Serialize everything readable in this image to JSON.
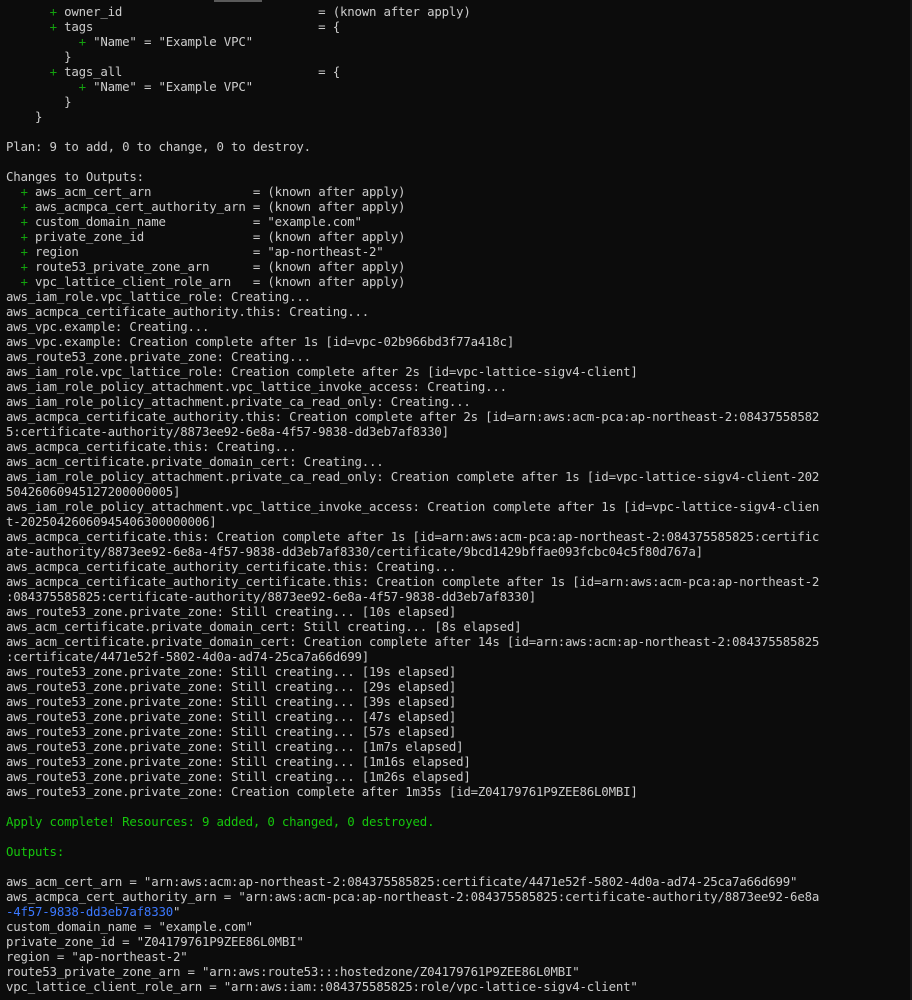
{
  "colors": {
    "background": "#0c0c0c",
    "text": "#cccccc",
    "plus": "#13a10e",
    "success": "#16c60c",
    "wrap_highlight": "#3b78ff"
  },
  "lines": [
    {
      "segs": [
        {
          "t": "      "
        },
        {
          "t": "+",
          "c": "plus"
        },
        {
          "t": " owner_id                           = (known after apply)"
        }
      ]
    },
    {
      "segs": [
        {
          "t": "      "
        },
        {
          "t": "+",
          "c": "plus"
        },
        {
          "t": " tags                               = {"
        }
      ]
    },
    {
      "segs": [
        {
          "t": "          "
        },
        {
          "t": "+",
          "c": "plus"
        },
        {
          "t": " \"Name\" = \"Example VPC\""
        }
      ]
    },
    {
      "segs": [
        {
          "t": "        }"
        }
      ]
    },
    {
      "segs": [
        {
          "t": "      "
        },
        {
          "t": "+",
          "c": "plus"
        },
        {
          "t": " tags_all                           = {"
        }
      ]
    },
    {
      "segs": [
        {
          "t": "          "
        },
        {
          "t": "+",
          "c": "plus"
        },
        {
          "t": " \"Name\" = \"Example VPC\""
        }
      ]
    },
    {
      "segs": [
        {
          "t": "        }"
        }
      ]
    },
    {
      "segs": [
        {
          "t": "    }"
        }
      ]
    },
    {
      "segs": [
        {
          "t": ""
        }
      ]
    },
    {
      "segs": [
        {
          "t": "Plan: 9 to add, 0 to change, 0 to destroy."
        }
      ]
    },
    {
      "segs": [
        {
          "t": ""
        }
      ]
    },
    {
      "segs": [
        {
          "t": "Changes to Outputs:"
        }
      ]
    },
    {
      "segs": [
        {
          "t": "  "
        },
        {
          "t": "+",
          "c": "plus"
        },
        {
          "t": " aws_acm_cert_arn              = (known after apply)"
        }
      ]
    },
    {
      "segs": [
        {
          "t": "  "
        },
        {
          "t": "+",
          "c": "plus"
        },
        {
          "t": " aws_acmpca_cert_authority_arn = (known after apply)"
        }
      ]
    },
    {
      "segs": [
        {
          "t": "  "
        },
        {
          "t": "+",
          "c": "plus"
        },
        {
          "t": " custom_domain_name            = \"example.com\""
        }
      ]
    },
    {
      "segs": [
        {
          "t": "  "
        },
        {
          "t": "+",
          "c": "plus"
        },
        {
          "t": " private_zone_id               = (known after apply)"
        }
      ]
    },
    {
      "segs": [
        {
          "t": "  "
        },
        {
          "t": "+",
          "c": "plus"
        },
        {
          "t": " region                        = \"ap-northeast-2\""
        }
      ]
    },
    {
      "segs": [
        {
          "t": "  "
        },
        {
          "t": "+",
          "c": "plus"
        },
        {
          "t": " route53_private_zone_arn      = (known after apply)"
        }
      ]
    },
    {
      "segs": [
        {
          "t": "  "
        },
        {
          "t": "+",
          "c": "plus"
        },
        {
          "t": " vpc_lattice_client_role_arn   = (known after apply)"
        }
      ]
    },
    {
      "segs": [
        {
          "t": "aws_iam_role.vpc_lattice_role: Creating..."
        }
      ]
    },
    {
      "segs": [
        {
          "t": "aws_acmpca_certificate_authority.this: Creating..."
        }
      ]
    },
    {
      "segs": [
        {
          "t": "aws_vpc.example: Creating..."
        }
      ]
    },
    {
      "segs": [
        {
          "t": "aws_vpc.example: Creation complete after 1s [id=vpc-02b966bd3f77a418c]"
        }
      ]
    },
    {
      "segs": [
        {
          "t": "aws_route53_zone.private_zone: Creating..."
        }
      ]
    },
    {
      "segs": [
        {
          "t": "aws_iam_role.vpc_lattice_role: Creation complete after 2s [id=vpc-lattice-sigv4-client]"
        }
      ]
    },
    {
      "segs": [
        {
          "t": "aws_iam_role_policy_attachment.vpc_lattice_invoke_access: Creating..."
        }
      ]
    },
    {
      "segs": [
        {
          "t": "aws_iam_role_policy_attachment.private_ca_read_only: Creating..."
        }
      ]
    },
    {
      "segs": [
        {
          "t": "aws_acmpca_certificate_authority.this: Creation complete after 2s [id=arn:aws:acm-pca:ap-northeast-2:08437558582"
        }
      ]
    },
    {
      "segs": [
        {
          "t": "5:certificate-authority/8873ee92-6e8a-4f57-9838-dd3eb7af8330]"
        }
      ]
    },
    {
      "segs": [
        {
          "t": "aws_acmpca_certificate.this: Creating..."
        }
      ]
    },
    {
      "segs": [
        {
          "t": "aws_acm_certificate.private_domain_cert: Creating..."
        }
      ]
    },
    {
      "segs": [
        {
          "t": "aws_iam_role_policy_attachment.private_ca_read_only: Creation complete after 1s [id=vpc-lattice-sigv4-client-202"
        }
      ]
    },
    {
      "segs": [
        {
          "t": "50426060945127200000005]"
        }
      ]
    },
    {
      "segs": [
        {
          "t": "aws_iam_role_policy_attachment.vpc_lattice_invoke_access: Creation complete after 1s [id=vpc-lattice-sigv4-clien"
        }
      ]
    },
    {
      "segs": [
        {
          "t": "t-20250426060945406300000006]"
        }
      ]
    },
    {
      "segs": [
        {
          "t": "aws_acmpca_certificate.this: Creation complete after 1s [id=arn:aws:acm-pca:ap-northeast-2:084375585825:certific"
        }
      ]
    },
    {
      "segs": [
        {
          "t": "ate-authority/8873ee92-6e8a-4f57-9838-dd3eb7af8330/certificate/9bcd1429bffae093fcbc04c5f80d767a]"
        }
      ]
    },
    {
      "segs": [
        {
          "t": "aws_acmpca_certificate_authority_certificate.this: Creating..."
        }
      ]
    },
    {
      "segs": [
        {
          "t": "aws_acmpca_certificate_authority_certificate.this: Creation complete after 1s [id=arn:aws:acm-pca:ap-northeast-2"
        }
      ]
    },
    {
      "segs": [
        {
          "t": ":084375585825:certificate-authority/8873ee92-6e8a-4f57-9838-dd3eb7af8330]"
        }
      ]
    },
    {
      "segs": [
        {
          "t": "aws_route53_zone.private_zone: Still creating... [10s elapsed]"
        }
      ]
    },
    {
      "segs": [
        {
          "t": "aws_acm_certificate.private_domain_cert: Still creating... [8s elapsed]"
        }
      ]
    },
    {
      "segs": [
        {
          "t": "aws_acm_certificate.private_domain_cert: Creation complete after 14s [id=arn:aws:acm:ap-northeast-2:084375585825"
        }
      ]
    },
    {
      "segs": [
        {
          "t": ":certificate/4471e52f-5802-4d0a-ad74-25ca7a66d699]"
        }
      ]
    },
    {
      "segs": [
        {
          "t": "aws_route53_zone.private_zone: Still creating... [19s elapsed]"
        }
      ]
    },
    {
      "segs": [
        {
          "t": "aws_route53_zone.private_zone: Still creating... [29s elapsed]"
        }
      ]
    },
    {
      "segs": [
        {
          "t": "aws_route53_zone.private_zone: Still creating... [39s elapsed]"
        }
      ]
    },
    {
      "segs": [
        {
          "t": "aws_route53_zone.private_zone: Still creating... [47s elapsed]"
        }
      ]
    },
    {
      "segs": [
        {
          "t": "aws_route53_zone.private_zone: Still creating... [57s elapsed]"
        }
      ]
    },
    {
      "segs": [
        {
          "t": "aws_route53_zone.private_zone: Still creating... [1m7s elapsed]"
        }
      ]
    },
    {
      "segs": [
        {
          "t": "aws_route53_zone.private_zone: Still creating... [1m16s elapsed]"
        }
      ]
    },
    {
      "segs": [
        {
          "t": "aws_route53_zone.private_zone: Still creating... [1m26s elapsed]"
        }
      ]
    },
    {
      "segs": [
        {
          "t": "aws_route53_zone.private_zone: Creation complete after 1m35s [id=Z04179761P9ZEE86L0MBI]"
        }
      ]
    },
    {
      "segs": [
        {
          "t": ""
        }
      ]
    },
    {
      "segs": [
        {
          "t": "Apply complete! Resources: 9 added, 0 changed, 0 destroyed.",
          "c": "green"
        }
      ]
    },
    {
      "segs": [
        {
          "t": ""
        }
      ]
    },
    {
      "segs": [
        {
          "t": "Outputs:",
          "c": "green"
        }
      ]
    },
    {
      "segs": [
        {
          "t": ""
        }
      ]
    },
    {
      "segs": [
        {
          "t": "aws_acm_cert_arn = \"arn:aws:acm:ap-northeast-2:084375585825:certificate/4471e52f-5802-4d0a-ad74-25ca7a66d699\""
        }
      ]
    },
    {
      "segs": [
        {
          "t": "aws_acmpca_cert_authority_arn = \"arn:aws:acm-pca:ap-northeast-2:084375585825:certificate-authority/8873ee92-6e8a"
        }
      ]
    },
    {
      "segs": [
        {
          "t": "-4f57-9838-dd3eb7af8330",
          "c": "blue"
        },
        {
          "t": "\""
        }
      ]
    },
    {
      "segs": [
        {
          "t": "custom_domain_name = \"example.com\""
        }
      ]
    },
    {
      "segs": [
        {
          "t": "private_zone_id = \"Z04179761P9ZEE86L0MBI\""
        }
      ]
    },
    {
      "segs": [
        {
          "t": "region = \"ap-northeast-2\""
        }
      ]
    },
    {
      "segs": [
        {
          "t": "route53_private_zone_arn = \"arn:aws:route53:::hostedzone/Z04179761P9ZEE86L0MBI\""
        }
      ]
    },
    {
      "segs": [
        {
          "t": "vpc_lattice_client_role_arn = \"arn:aws:iam::084375585825:role/vpc-lattice-sigv4-client\""
        }
      ]
    }
  ]
}
